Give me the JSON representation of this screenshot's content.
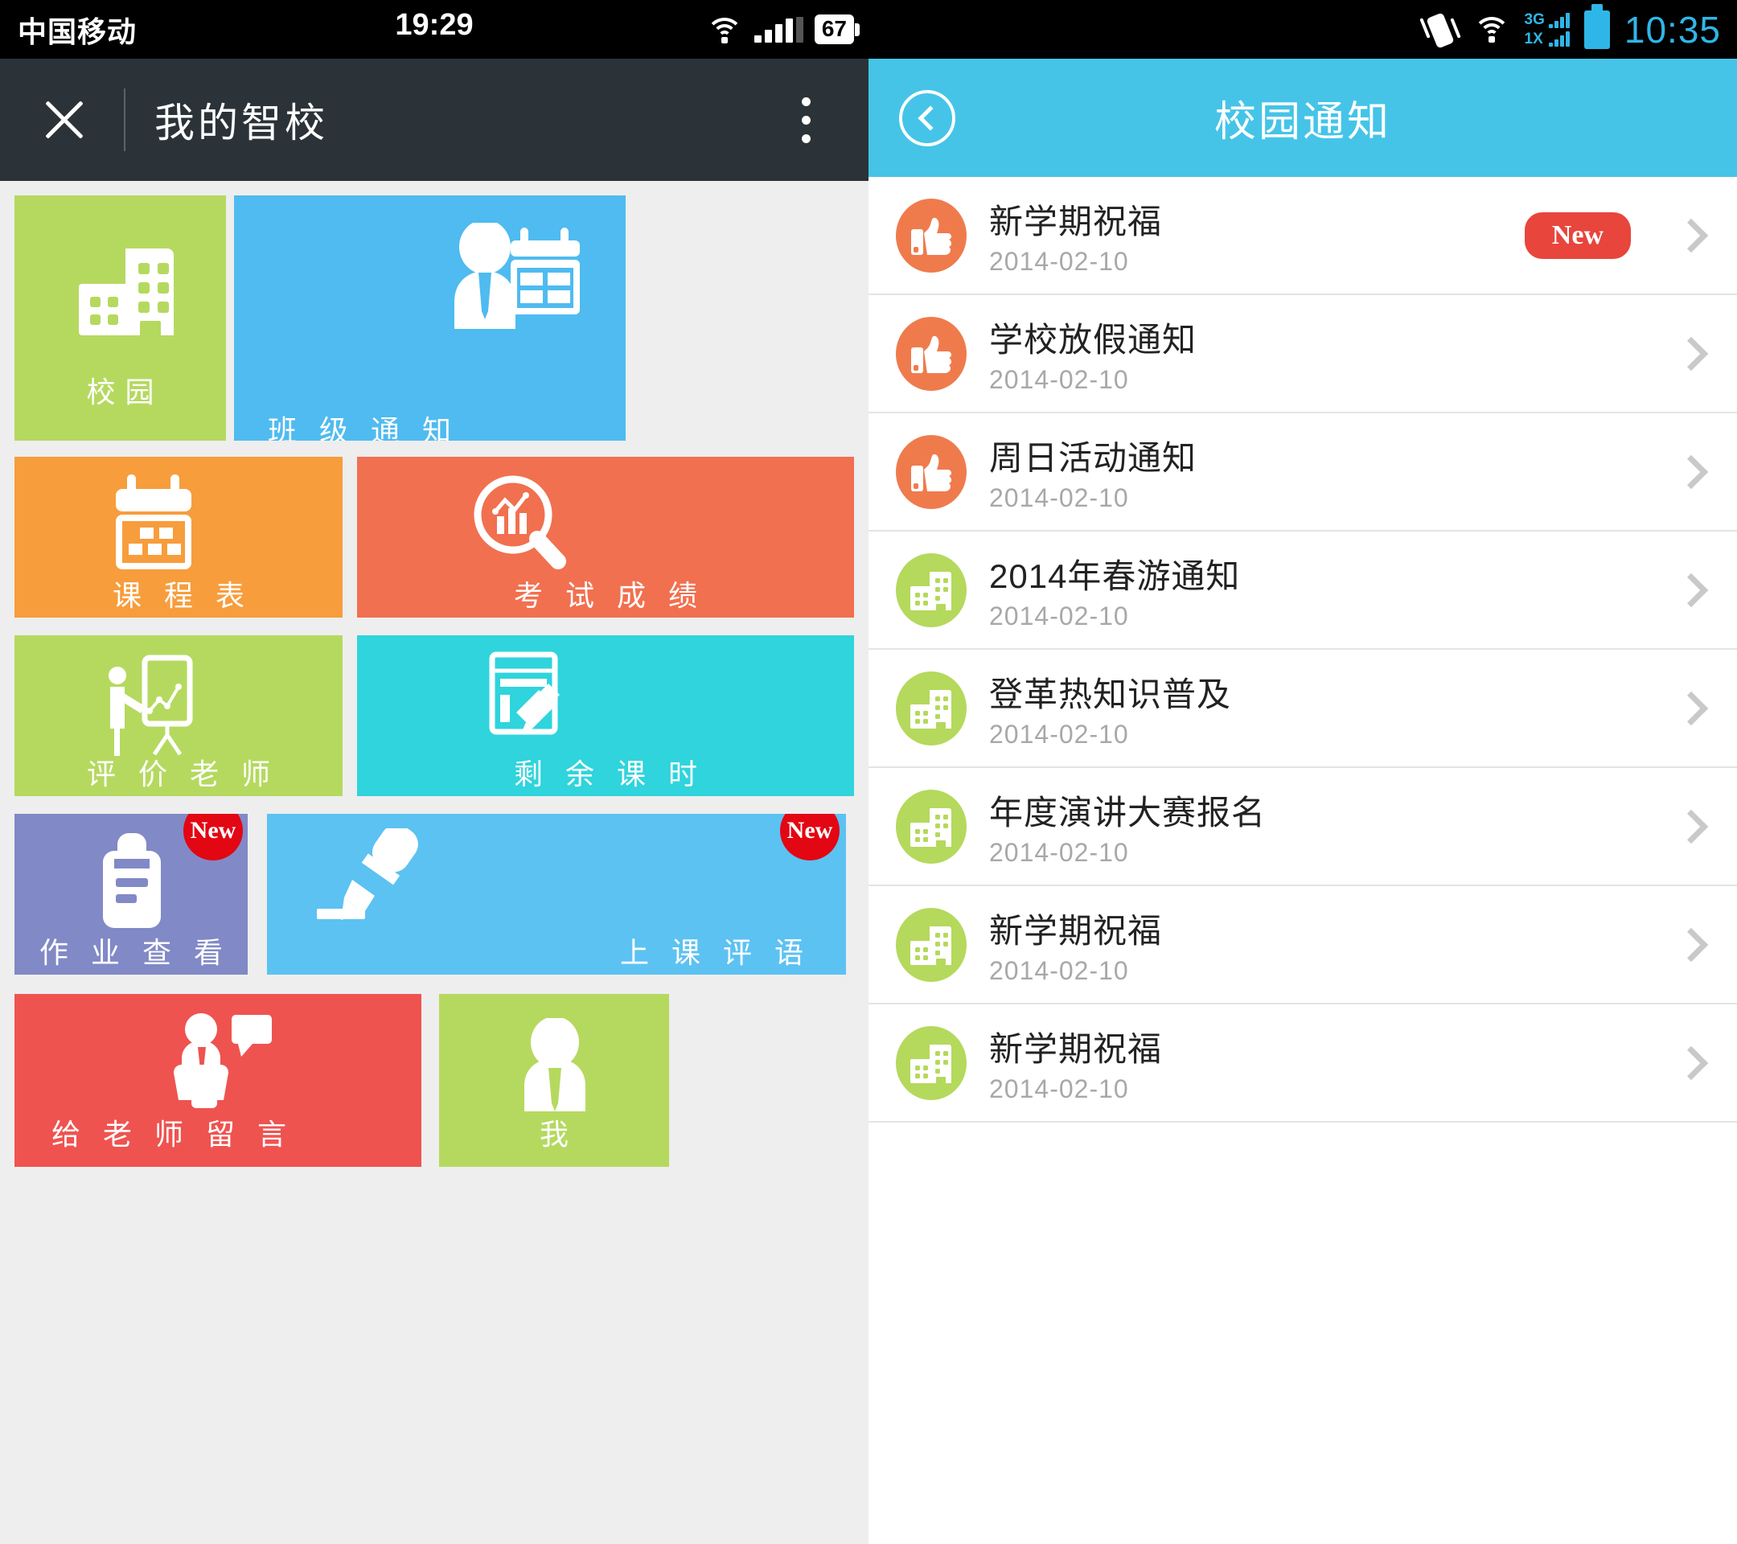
{
  "left": {
    "status": {
      "carrier": "中国移动",
      "time": "19:29",
      "battery": "67",
      "wifi_icon": "wifi-icon",
      "signal_icon": "signal-bars-icon"
    },
    "appbar": {
      "close_icon": "close-icon",
      "title": "我的智校",
      "overflow_icon": "overflow-menu-icon"
    },
    "tiles": [
      {
        "label": "校园",
        "color": "#b5d95f",
        "icon": "school-building-icon",
        "new": false
      },
      {
        "label": "班 级 通 知",
        "color": "#4fbbf0",
        "icon": "person-calendar-icon",
        "new": false
      },
      {
        "label": "课 程 表",
        "color": "#f79d3c",
        "icon": "calendar-icon",
        "new": false
      },
      {
        "label": "考 试 成 绩",
        "color": "#f1704f",
        "icon": "chart-magnifier-icon",
        "new": false
      },
      {
        "label": "评 价 老 师",
        "color": "#b5d95f",
        "icon": "teacher-board-icon",
        "new": false
      },
      {
        "label": "剩 余 课 时",
        "color": "#2fd4dc",
        "icon": "document-edit-icon",
        "new": false
      },
      {
        "label": "作 业 查 看",
        "color": "#8189c6",
        "icon": "clipboard-icon",
        "new": true,
        "new_label": "New"
      },
      {
        "label": "上 课 评 语",
        "color": "#5cc2f2",
        "icon": "pen-write-icon",
        "new": true,
        "new_label": "New"
      },
      {
        "label": "给 老 师 留 言",
        "color": "#ef5350",
        "icon": "teacher-message-icon",
        "new": false
      },
      {
        "label": "我",
        "color": "#b5d95f",
        "icon": "user-icon",
        "new": false
      }
    ]
  },
  "right": {
    "status": {
      "vibrate_icon": "vibrate-icon",
      "wifi_icon": "wifi-icon",
      "net_3g": "3G",
      "net_1x": "1X",
      "battery_icon": "battery-icon",
      "time": "10:35"
    },
    "header": {
      "back_icon": "back-arrow-icon",
      "title": "校园通知"
    },
    "items": [
      {
        "title": "新学期祝福",
        "date": "2014-02-10",
        "icon": "thumbs-up-icon",
        "avatar_color": "#ef7b4d",
        "badge": "New"
      },
      {
        "title": "学校放假通知",
        "date": "2014-02-10",
        "icon": "thumbs-up-icon",
        "avatar_color": "#ef7b4d",
        "badge": ""
      },
      {
        "title": "周日活动通知",
        "date": "2014-02-10",
        "icon": "thumbs-up-icon",
        "avatar_color": "#ef7b4d",
        "badge": ""
      },
      {
        "title": "2014年春游通知",
        "date": "2014-02-10",
        "icon": "building-icon",
        "avatar_color": "#b4d95c",
        "badge": ""
      },
      {
        "title": "登革热知识普及",
        "date": "2014-02-10",
        "icon": "building-icon",
        "avatar_color": "#b4d95c",
        "badge": ""
      },
      {
        "title": "年度演讲大赛报名",
        "date": "2014-02-10",
        "icon": "building-icon",
        "avatar_color": "#b4d95c",
        "badge": ""
      },
      {
        "title": "新学期祝福",
        "date": "2014-02-10",
        "icon": "building-icon",
        "avatar_color": "#b4d95c",
        "badge": ""
      },
      {
        "title": "新学期祝福",
        "date": "2014-02-10",
        "icon": "building-icon",
        "avatar_color": "#b4d95c",
        "badge": ""
      }
    ],
    "chevron_icon": "chevron-right-icon"
  }
}
